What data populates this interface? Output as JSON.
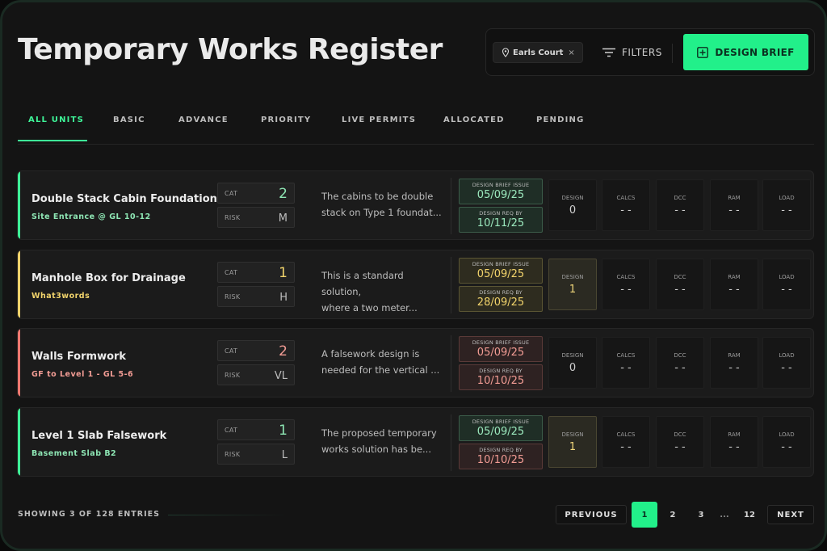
{
  "header": {
    "title": "Temporary Works Register",
    "location_chip": "Earls Court",
    "location_chip_close": "×",
    "filters_label": "FILTERS",
    "design_brief_label": "DESIGN BRIEF"
  },
  "tabs": [
    {
      "label": "ALL UNITS",
      "active": true
    },
    {
      "label": "BASIC"
    },
    {
      "label": "ADVANCE"
    },
    {
      "label": "PRIORITY"
    },
    {
      "label": "LIVE PERMITS"
    },
    {
      "label": "ALLOCATED"
    },
    {
      "label": "PENDING"
    }
  ],
  "labels": {
    "cat": "CAT",
    "risk": "RISK",
    "design_brief_issue": "DESIGN BRIEF ISSUE",
    "design_req_by": "DESIGN REQ BY",
    "design": "DESIGN",
    "calcs": "CALCS",
    "dcc": "DCC",
    "ram": "RAM",
    "load": "LOAD"
  },
  "rows": [
    {
      "title": "Double Stack Cabin Foundation",
      "location": "Site Entrance @ GL 10-12",
      "cat": "2",
      "risk": "M",
      "desc_line1": "The cabins to be double",
      "desc_line2": "stack on Type 1 foundat...",
      "issue_date": "05/09/25",
      "req_date": "10/11/25",
      "design": "0",
      "calcs": "- -",
      "dcc": "- -",
      "ram": "- -",
      "load": "- -"
    },
    {
      "title": "Manhole Box for Drainage",
      "location": "What3words",
      "cat": "1",
      "risk": "H",
      "desc_line1": "This is a standard solution,",
      "desc_line2": "where a two meter...",
      "issue_date": "05/09/25",
      "req_date": "28/09/25",
      "design": "1",
      "calcs": "- -",
      "dcc": "- -",
      "ram": "- -",
      "load": "- -"
    },
    {
      "title": "Walls Formwork",
      "location": "GF to Level 1 - GL 5-6",
      "cat": "2",
      "risk": "VL",
      "desc_line1": "A falsework design is",
      "desc_line2": "needed for the vertical ...",
      "issue_date": "05/09/25",
      "req_date": "10/10/25",
      "design": "0",
      "calcs": "- -",
      "dcc": "- -",
      "ram": "- -",
      "load": "- -"
    },
    {
      "title": "Level 1 Slab Falsework",
      "location": "Basement Slab B2",
      "cat": "1",
      "risk": "L",
      "desc_line1": "The proposed temporary",
      "desc_line2": "works solution has be...",
      "issue_date": "05/09/25",
      "req_date": "10/10/25",
      "design": "1",
      "calcs": "- -",
      "dcc": "- -",
      "ram": "- -",
      "load": "- -"
    }
  ],
  "footer": {
    "showing": "SHOWING 3 OF 128 ENTRIES",
    "previous": "PREVIOUS",
    "next": "NEXT",
    "pages": [
      "1",
      "2",
      "3",
      "...",
      "12"
    ],
    "current_page": "1"
  },
  "colors": {
    "accent_green": "#22f08a",
    "accent_yellow": "#f1d36b",
    "accent_red": "#f07870",
    "green_text": "#8ee6b4",
    "yellow_text": "#f1d36b",
    "red_text": "#f29c94"
  }
}
